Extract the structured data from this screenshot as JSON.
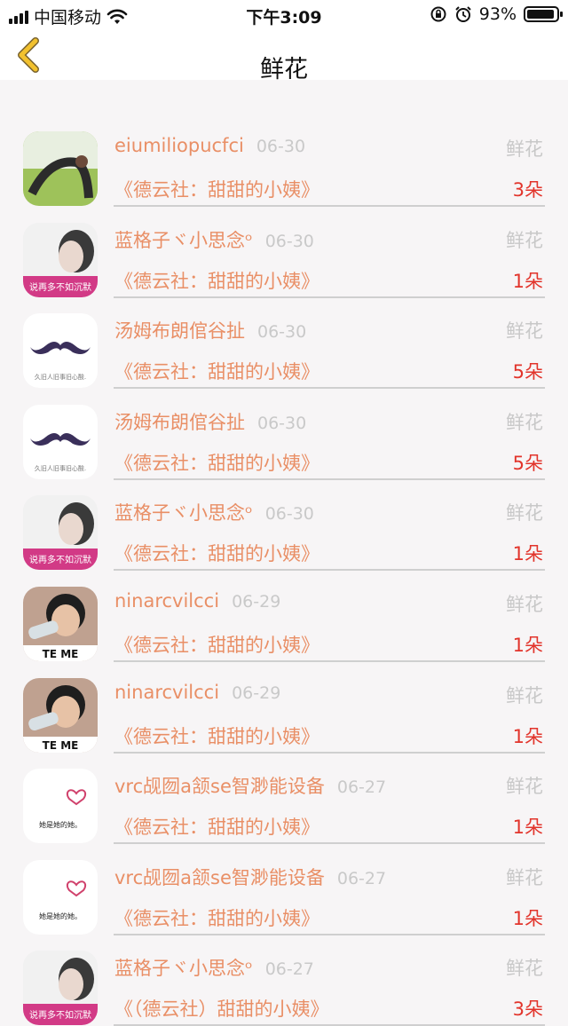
{
  "status_bar": {
    "carrier": "中国移动",
    "time": "下午3:09",
    "battery": "93%",
    "battery_level": 0.93,
    "icons": [
      "signal-icon",
      "wifi-icon",
      "rotation-lock-icon",
      "alarm-icon",
      "battery-icon"
    ]
  },
  "nav": {
    "title": "鲜花",
    "back_icon": "chevron-left-icon",
    "accent_color": "#f2c12e"
  },
  "colors": {
    "name": "#e98f66",
    "date": "#c9c9c9",
    "count": "#e2342b",
    "divider": "#cfcfcf"
  },
  "records": [
    {
      "name": "",
      "date": "",
      "gift_label": "",
      "work": "《德云社：甜甜的小姨》",
      "count": "3朵",
      "avatar": "yoga"
    },
    {
      "name": "eiumiliopucfci",
      "date": "06-30",
      "gift_label": "鲜花",
      "work": "《德云社：甜甜的小姨》",
      "count": "3朵",
      "avatar": "yoga"
    },
    {
      "name": "蓝格子ヾ小思念ᵒ",
      "date": "06-30",
      "gift_label": "鲜花",
      "work": "《德云社：甜甜的小姨》",
      "count": "1朵",
      "avatar": "girl",
      "avatar_caption": "说再多不如沉默"
    },
    {
      "name": "汤姆布朗倌谷扯",
      "date": "06-30",
      "gift_label": "鲜花",
      "work": "《德云社：甜甜的小姨》",
      "count": "5朵",
      "avatar": "mustache",
      "avatar_caption": "久旧人旧事旧心酸."
    },
    {
      "name": "汤姆布朗倌谷扯",
      "date": "06-30",
      "gift_label": "鲜花",
      "work": "《德云社：甜甜的小姨》",
      "count": "5朵",
      "avatar": "mustache",
      "avatar_caption": "久旧人旧事旧心酸."
    },
    {
      "name": "蓝格子ヾ小思念ᵒ",
      "date": "06-30",
      "gift_label": "鲜花",
      "work": "《德云社：甜甜的小姨》",
      "count": "1朵",
      "avatar": "girl",
      "avatar_caption": "说再多不如沉默"
    },
    {
      "name": "ninarcvilcci",
      "date": "06-29",
      "gift_label": "鲜花",
      "work": "《德云社：甜甜的小姨》",
      "count": "1朵",
      "avatar": "boy",
      "avatar_caption": "TE ME"
    },
    {
      "name": "ninarcvilcci",
      "date": "06-29",
      "gift_label": "鲜花",
      "work": "《德云社：甜甜的小姨》",
      "count": "1朵",
      "avatar": "boy",
      "avatar_caption": "TE ME"
    },
    {
      "name": "vrc觇囫a颔se智渺能设备",
      "date": "06-27",
      "gift_label": "鲜花",
      "work": "《德云社：甜甜的小姨》",
      "count": "1朵",
      "avatar": "heart",
      "avatar_caption": "她是她的她。"
    },
    {
      "name": "vrc觇囫a颔se智渺能设备",
      "date": "06-27",
      "gift_label": "鲜花",
      "work": "《德云社：甜甜的小姨》",
      "count": "1朵",
      "avatar": "heart",
      "avatar_caption": "她是她的她。"
    },
    {
      "name": "蓝格子ヾ小思念ᵒ",
      "date": "06-27",
      "gift_label": "鲜花",
      "work": "《（德云社）甜甜的小姨》",
      "count": "3朵",
      "avatar": "girl",
      "avatar_caption": "说再多不如沉默"
    }
  ]
}
